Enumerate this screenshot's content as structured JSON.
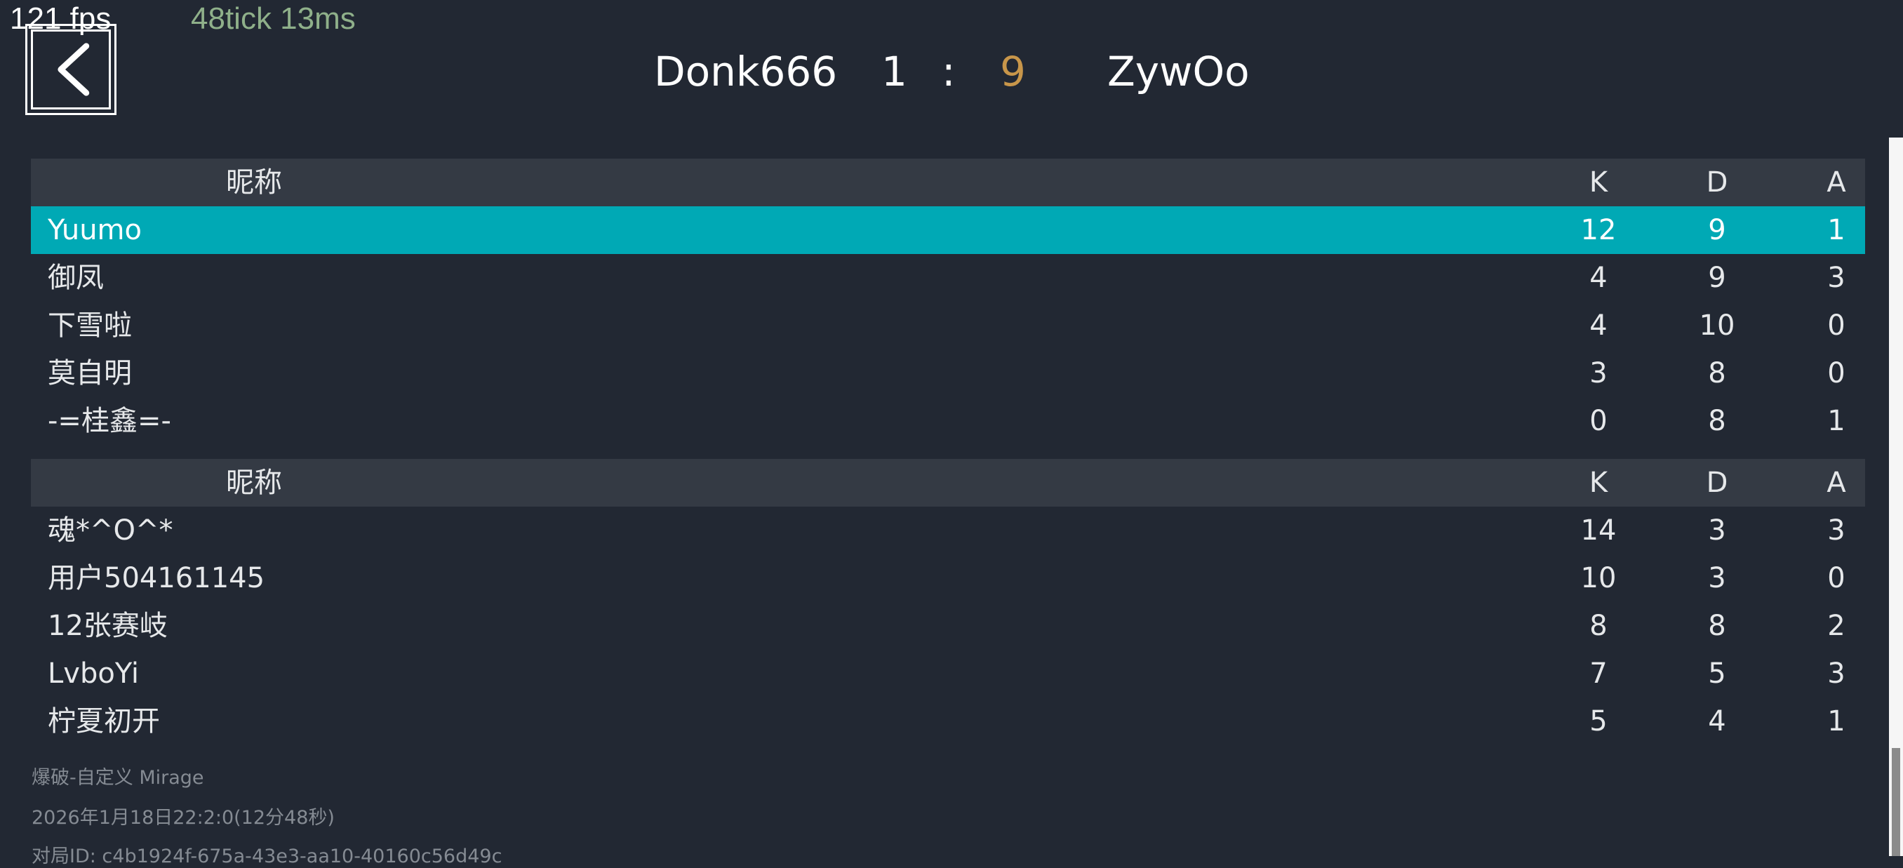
{
  "debug": {
    "fps": "121 fps",
    "tick": "48tick 13ms"
  },
  "icons": {
    "back": "chevron-left-icon"
  },
  "colors": {
    "background": "#222833",
    "header_row": "#343a44",
    "selected_row": "#00a9b5",
    "score_highlight": "#c8964a"
  },
  "match": {
    "team_left": "Donk666",
    "score_left": "1",
    "separator": ":",
    "score_right": "9",
    "team_right": "ZywOo"
  },
  "table1": {
    "header": {
      "name": "昵称",
      "k": "K",
      "d": "D",
      "a": "A"
    },
    "rows": [
      {
        "name": "Yuumo",
        "k": "12",
        "d": "9",
        "a": "1",
        "selected": true
      },
      {
        "name": "御凤",
        "k": "4",
        "d": "9",
        "a": "3"
      },
      {
        "name": "下雪啦",
        "k": "4",
        "d": "10",
        "a": "0"
      },
      {
        "name": "莫自明",
        "k": "3",
        "d": "8",
        "a": "0"
      },
      {
        "name": "-=桂鑫=-",
        "k": "0",
        "d": "8",
        "a": "1"
      }
    ]
  },
  "table2": {
    "header": {
      "name": "昵称",
      "k": "K",
      "d": "D",
      "a": "A"
    },
    "rows": [
      {
        "name": "魂*^O^*",
        "k": "14",
        "d": "3",
        "a": "3"
      },
      {
        "name": "用户504161145",
        "k": "10",
        "d": "3",
        "a": "0"
      },
      {
        "name": "12张赛岐",
        "k": "8",
        "d": "8",
        "a": "2"
      },
      {
        "name": "LvboYi",
        "k": "7",
        "d": "5",
        "a": "3"
      },
      {
        "name": "柠夏初开",
        "k": "5",
        "d": "4",
        "a": "1"
      }
    ]
  },
  "info": {
    "mode": "爆破-自定义 Mirage",
    "datetime": "2026年1月18日22:2:0(12分48秒)",
    "match_id": "对局ID: c4b1924f-675a-43e3-aa10-40160c56d49c"
  }
}
